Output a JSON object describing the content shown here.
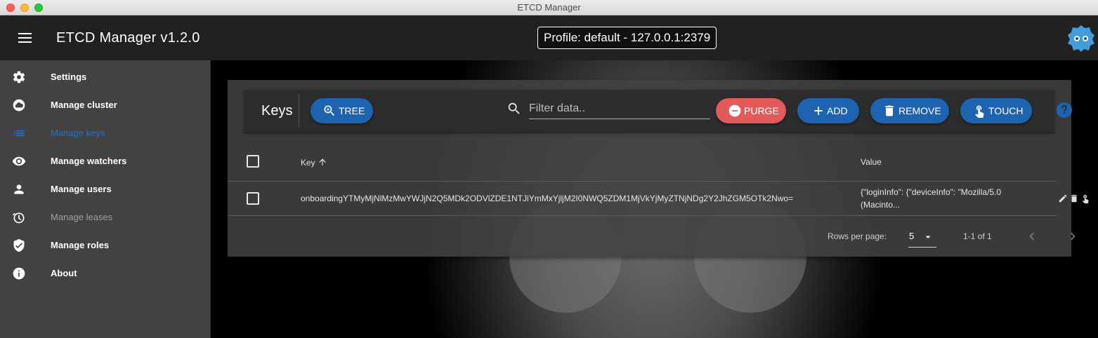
{
  "window": {
    "title": "ETCD Manager"
  },
  "appbar": {
    "title": "ETCD Manager v1.2.0",
    "profile": "Profile: default - 127.0.0.1:2379"
  },
  "sidebar": {
    "items": [
      {
        "label": "Settings",
        "icon": "gear-icon"
      },
      {
        "label": "Manage cluster",
        "icon": "cloud-icon"
      },
      {
        "label": "Manage keys",
        "icon": "list-icon"
      },
      {
        "label": "Manage watchers",
        "icon": "eye-icon"
      },
      {
        "label": "Manage users",
        "icon": "person-icon"
      },
      {
        "label": "Manage leases",
        "icon": "timer-icon"
      },
      {
        "label": "Manage roles",
        "icon": "shield-icon"
      },
      {
        "label": "About",
        "icon": "info-icon"
      }
    ]
  },
  "toolbar": {
    "title": "Keys",
    "tree_label": "TREE",
    "filter_placeholder": "Filter data..",
    "purge_label": "PURGE",
    "add_label": "ADD",
    "remove_label": "REMOVE",
    "touch_label": "TOUCH"
  },
  "table": {
    "headers": {
      "key": "Key",
      "value": "Value"
    },
    "rows": [
      {
        "key": "onboardingYTMyMjNlMzMwYWJjN2Q5MDk2ODVlZDE1NTJiYmMxYjljM2I0NWQ5ZDM1MjVkYjMyZTNjNDg2Y2JhZGM5OTk2Nwo=",
        "value_line1": "{\"loginInfo\": {\"deviceInfo\": \"Mozilla/5.0",
        "value_line2": "(Macinto..."
      }
    ]
  },
  "pagination": {
    "rows_per_page_label": "Rows per page:",
    "rows_per_page": "5",
    "range": "1-1 of 1"
  },
  "colors": {
    "primary": "#1e63b0",
    "danger": "#e25a5a",
    "active_nav": "#1976d2"
  }
}
